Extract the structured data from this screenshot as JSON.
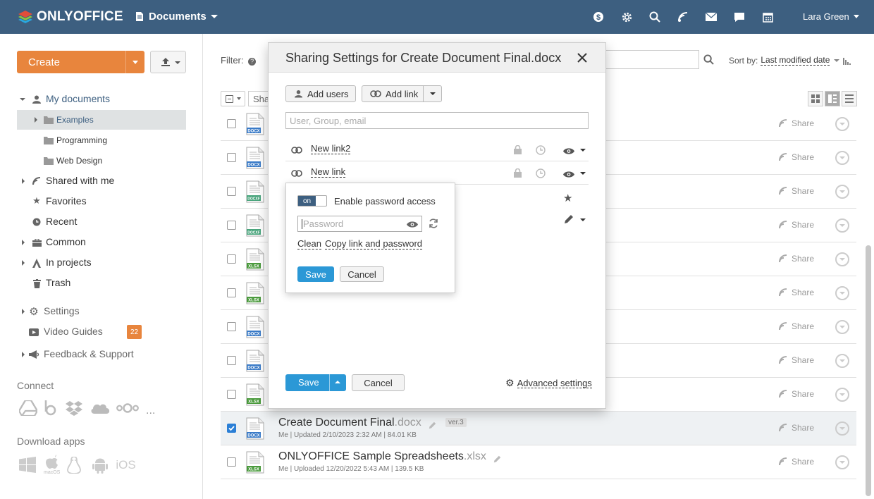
{
  "header": {
    "logo_text": "ONLYOFFICE",
    "module": "Documents",
    "user": "Lara Green"
  },
  "sidebar": {
    "create_label": "Create",
    "tree": {
      "my_documents": "My documents",
      "examples": "Examples",
      "programming": "Programming",
      "web_design": "Web Design",
      "shared_with_me": "Shared with me",
      "favorites": "Favorites",
      "recent": "Recent",
      "common": "Common",
      "in_projects": "In projects",
      "trash": "Trash",
      "settings": "Settings",
      "video_guides": "Video Guides",
      "video_guides_badge": "22",
      "feedback": "Feedback & Support"
    },
    "connect_title": "Connect",
    "connect_more": "...",
    "download_title": "Download apps",
    "ios_label": "iOS",
    "macos_label": "macOS"
  },
  "toolbar": {
    "filter_label": "Filter:",
    "sort_label": "Sort by:",
    "sort_value": "Last modified date",
    "share_partial": "Sha"
  },
  "files": [
    {
      "type": "DOCX",
      "color": "#3a7bc8",
      "checked": false
    },
    {
      "type": "DOCX",
      "color": "#3a7bc8",
      "checked": false
    },
    {
      "type": "DOCXF",
      "color": "#4aa57d",
      "checked": false
    },
    {
      "type": "DOCXF",
      "color": "#4aa57d",
      "checked": false
    },
    {
      "type": "XLSX",
      "color": "#4a9a3c",
      "checked": false
    },
    {
      "type": "XLSX",
      "color": "#4a9a3c",
      "checked": false
    },
    {
      "type": "DOCX",
      "color": "#3a7bc8",
      "checked": false
    },
    {
      "type": "DOCX",
      "color": "#3a7bc8",
      "checked": false
    },
    {
      "type": "XLSX",
      "color": "#4a9a3c",
      "checked": false
    },
    {
      "type": "DOCX",
      "color": "#3a7bc8",
      "checked": true,
      "name": "Create Document Final",
      "ext": ".docx",
      "meta": "Me | Updated 2/10/2023 2:32 AM | 84.01 KB",
      "version": "ver.3"
    },
    {
      "type": "XLSX",
      "color": "#4a9a3c",
      "checked": false,
      "name": "ONLYOFFICE Sample Spreadsheets",
      "ext": ".xlsx",
      "meta": "Me | Uploaded 12/20/2022 5:43 AM | 139.5 KB"
    }
  ],
  "share_label": "Share",
  "modal": {
    "title": "Sharing Settings for Create Document Final.docx",
    "add_users": "Add users",
    "add_link": "Add link",
    "search_placeholder": "User, Group, email",
    "links": [
      "New link2",
      "New link"
    ],
    "save": "Save",
    "cancel": "Cancel",
    "advanced": "Advanced settings"
  },
  "password_popup": {
    "toggle": "on",
    "enable_label": "Enable password access",
    "placeholder": "Password",
    "clean": "Clean",
    "copy": "Copy link and password",
    "save": "Save",
    "cancel": "Cancel"
  },
  "colors": {
    "header_bg": "#3d5f80",
    "accent_orange": "#e8853d",
    "accent_blue": "#2b98d6"
  }
}
